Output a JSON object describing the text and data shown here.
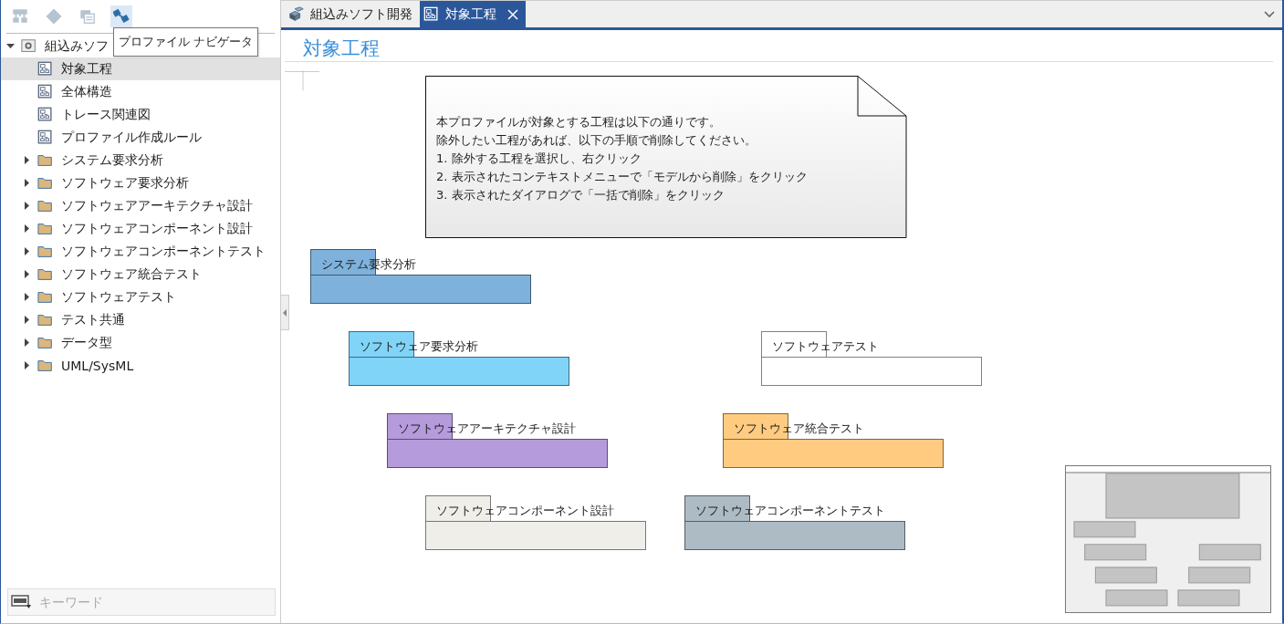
{
  "toolbar": {
    "buttons": [
      {
        "kind": "hierarchy",
        "disabled": true
      },
      {
        "kind": "diamond",
        "disabled": true
      },
      {
        "kind": "windows",
        "disabled": true
      },
      {
        "kind": "navigator",
        "disabled": false,
        "hovered": true
      }
    ],
    "tooltip": "プロファイル ナビゲータ"
  },
  "tree": [
    {
      "label": "組込みソフ",
      "kind": "model",
      "expanded": true,
      "selected": false,
      "children": [
        {
          "label": "対象工程",
          "kind": "diagram",
          "selected": true
        },
        {
          "label": "全体構造",
          "kind": "diagram",
          "selected": false
        },
        {
          "label": "トレース関連図",
          "kind": "diagram",
          "selected": false
        },
        {
          "label": "プロファイル作成ルール",
          "kind": "diagram",
          "selected": false
        },
        {
          "label": "システム要求分析",
          "kind": "folder",
          "expanded": false,
          "selected": false
        },
        {
          "label": "ソフトウェア要求分析",
          "kind": "folder",
          "expanded": false,
          "selected": false
        },
        {
          "label": "ソフトウェアアーキテクチャ設計",
          "kind": "folder",
          "expanded": false,
          "selected": false
        },
        {
          "label": "ソフトウェアコンポーネント設計",
          "kind": "folder",
          "expanded": false,
          "selected": false
        },
        {
          "label": "ソフトウェアコンポーネントテスト",
          "kind": "folder",
          "expanded": false,
          "selected": false
        },
        {
          "label": "ソフトウェア統合テスト",
          "kind": "folder",
          "expanded": false,
          "selected": false
        },
        {
          "label": "ソフトウェアテスト",
          "kind": "folder",
          "expanded": false,
          "selected": false
        },
        {
          "label": "テスト共通",
          "kind": "folder",
          "expanded": false,
          "selected": false
        },
        {
          "label": "データ型",
          "kind": "folder",
          "expanded": false,
          "selected": false
        },
        {
          "label": "UML/SysML",
          "kind": "folder",
          "expanded": false,
          "selected": false
        }
      ]
    }
  ],
  "search": {
    "placeholder": "キーワード"
  },
  "tabs": [
    {
      "label": "組込みソフト開発",
      "kind": "model",
      "selected": false,
      "closable": false
    },
    {
      "label": "対象工程",
      "kind": "diagram",
      "selected": true,
      "closable": true
    }
  ],
  "diagram": {
    "title": "対象工程",
    "note": {
      "lines": [
        "本プロファイルが対象とする工程は以下の通りです。",
        "除外したい工程があれば、以下の手順で削除してください。",
        "1. 除外する工程を選択し、右クリック",
        "2. 表示されたコンテキストメニューで「モデルから削除」をクリック",
        "3. 表示されたダイアログで「一括で削除」をクリック"
      ]
    },
    "packages": [
      {
        "label": "システム要求分析",
        "color": "#7eb2dc"
      },
      {
        "label": "ソフトウェア要求分析",
        "color": "#80d4f8"
      },
      {
        "label": "ソフトウェアテスト",
        "color": "#ffffff"
      },
      {
        "label": "ソフトウェアアーキテクチャ設計",
        "color": "#b59bdb"
      },
      {
        "label": "ソフトウェア統合テスト",
        "color": "#ffcb80"
      },
      {
        "label": "ソフトウェアコンポーネント設計",
        "color": "#f0eee8"
      },
      {
        "label": "ソフトウェアコンポーネントテスト",
        "color": "#adbbc4"
      }
    ]
  }
}
